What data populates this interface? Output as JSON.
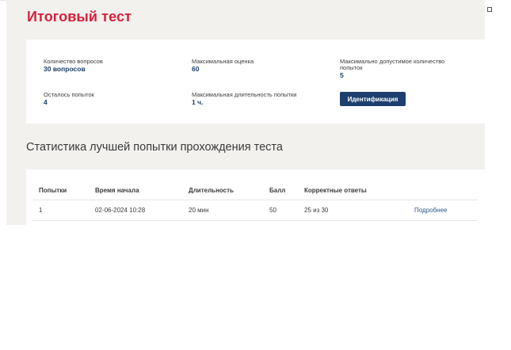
{
  "page": {
    "title": "Итоговый тест"
  },
  "info": {
    "questions_count": {
      "label": "Количество вопросов",
      "value": "30 вопросов"
    },
    "max_score": {
      "label": "Максимальная оценка",
      "value": "60"
    },
    "max_attempts": {
      "label": "Максимально допустимое количество попыток",
      "value": "5"
    },
    "attempts_left": {
      "label": "Осталось попыток",
      "value": "4"
    },
    "max_duration": {
      "label": "Максимальная длительность попытки",
      "value": "1 ч."
    },
    "identify_button": "Идентификация"
  },
  "stats": {
    "title": "Статистика лучшей попытки прохождения теста",
    "columns": [
      "Попытки",
      "Время начала",
      "Длительность",
      "Балл",
      "Корректные ответы"
    ],
    "rows": [
      {
        "attempt": "1",
        "start": "02-06-2024 10:28",
        "duration": "20 мин",
        "score": "50",
        "correct": "25 из 30",
        "details": "Подробнее"
      }
    ]
  },
  "colors": {
    "title_red": "#d5213c",
    "accent_blue": "#1c3f6d",
    "link_blue": "#2a5a92",
    "panel_bg": "#f2f1ee"
  }
}
